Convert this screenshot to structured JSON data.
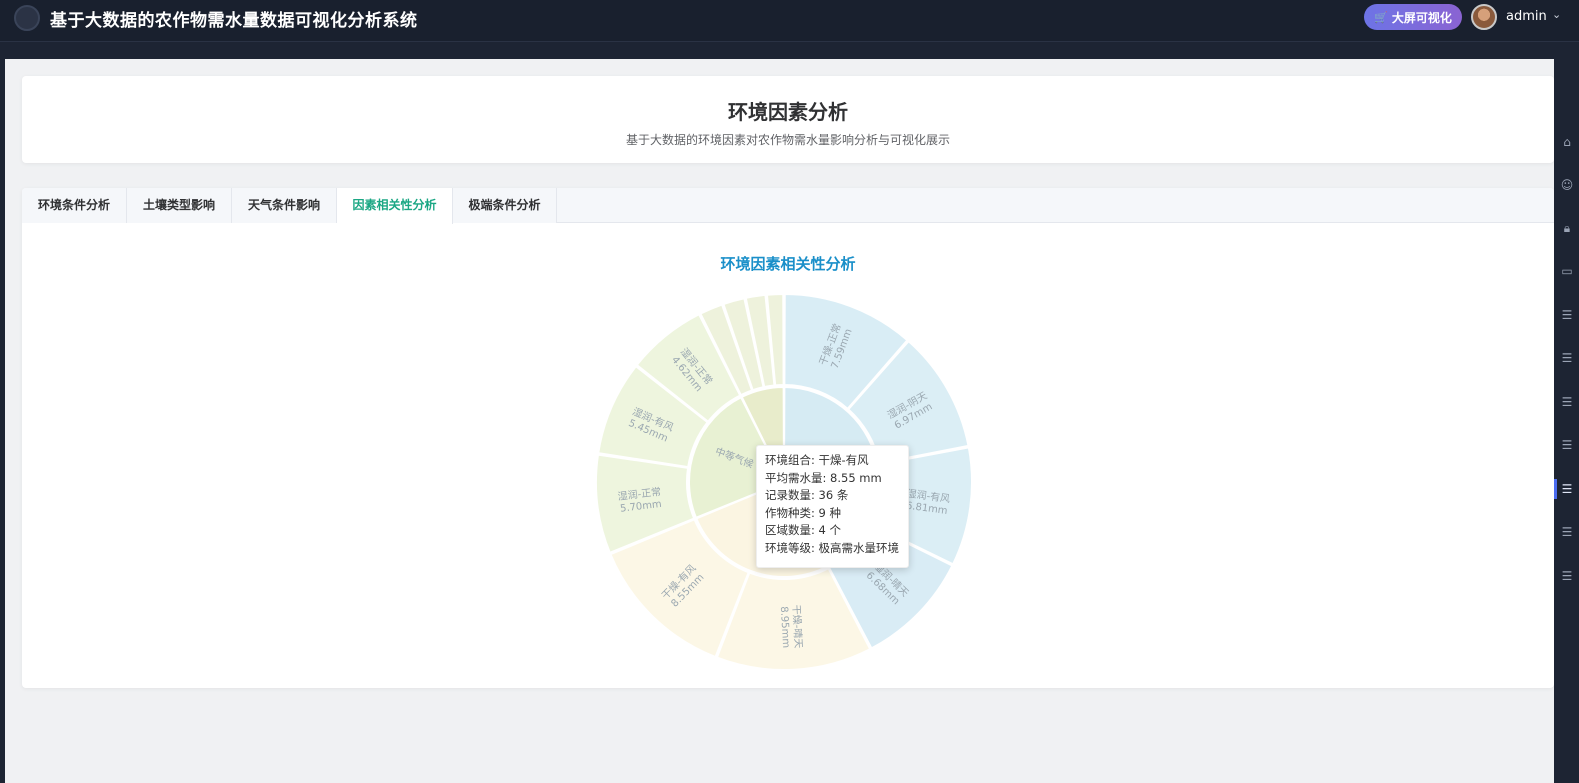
{
  "app": {
    "title": "基于大数据的农作物需水量数据可视化分析系统",
    "bigscreen_label": "大屏可视化",
    "user": "admin"
  },
  "page": {
    "title": "环境因素分析",
    "subtitle": "基于大数据的环境因素对农作物需水量影响分析与可视化展示"
  },
  "tabs": [
    {
      "label": "环境条件分析",
      "active": false
    },
    {
      "label": "土壤类型影响",
      "active": false
    },
    {
      "label": "天气条件影响",
      "active": false
    },
    {
      "label": "因素相关性分析",
      "active": true
    },
    {
      "label": "极端条件分析",
      "active": false
    }
  ],
  "chart_data": {
    "type": "sunburst",
    "title": "环境因素相关性分析",
    "segments": [
      {
        "name": "干燥-正常",
        "value": 7.59,
        "label": "7.59mm",
        "color": "#d9edf5"
      },
      {
        "name": "湿润-阴天",
        "value": 6.97,
        "label": "6.97mm",
        "color": "#dbeef5"
      },
      {
        "name": "湿润-有风",
        "value": 6.81,
        "label": "6.81mm",
        "color": "#dbeef5"
      },
      {
        "name": "湿润-晴天",
        "value": 6.68,
        "label": "6.68mm",
        "color": "#d9ecf5"
      },
      {
        "name": "干燥-晴天",
        "value": 8.95,
        "label": "8.95mm",
        "color": "#fcf7e6"
      },
      {
        "name": "干燥-有风",
        "value": 8.55,
        "label": "8.55mm",
        "color": "#fcf7e6"
      },
      {
        "name": "湿润-正常",
        "value": 5.7,
        "label": "5.70mm",
        "color": "#eef5de"
      },
      {
        "name": "湿润-有风",
        "value": 5.45,
        "label": "5.45mm",
        "color": "#eef5de"
      },
      {
        "name": "湿润-正常",
        "value": 4.62,
        "label": "4.62mm",
        "color": "#eef5de"
      },
      {
        "name": "",
        "value": 1.4,
        "label": "",
        "color": "#eef2dc"
      },
      {
        "name": "",
        "value": 1.3,
        "label": "",
        "color": "#eef2dc"
      },
      {
        "name": "",
        "value": 1.2,
        "label": "",
        "color": "#eef2dc"
      },
      {
        "name": "",
        "value": 1.0,
        "label": "",
        "color": "#eef2dc"
      }
    ],
    "inner": [
      {
        "name": "",
        "value": 28.05,
        "color": "#d6ebf3"
      },
      {
        "name": "",
        "value": 17.5,
        "color": "#fbf5e2"
      },
      {
        "name": "中等气候",
        "value": 15.77,
        "color": "#e8f1d3"
      },
      {
        "name": "",
        "value": 4.9,
        "color": "#e8eccb"
      }
    ]
  },
  "tooltip": {
    "lines": [
      "环境组合: 干燥-有风",
      "平均需水量: 8.55 mm",
      "记录数量: 36 条",
      "作物种类: 9 种",
      "区域数量: 4 个",
      "环境等级: 极高需水量环境"
    ]
  },
  "sidebar_icons": [
    "home-icon",
    "user-icon",
    "lock-icon",
    "chat-icon",
    "document-icon",
    "document-icon",
    "document-icon",
    "document-icon",
    "document-icon",
    "document-icon",
    "document-icon"
  ]
}
